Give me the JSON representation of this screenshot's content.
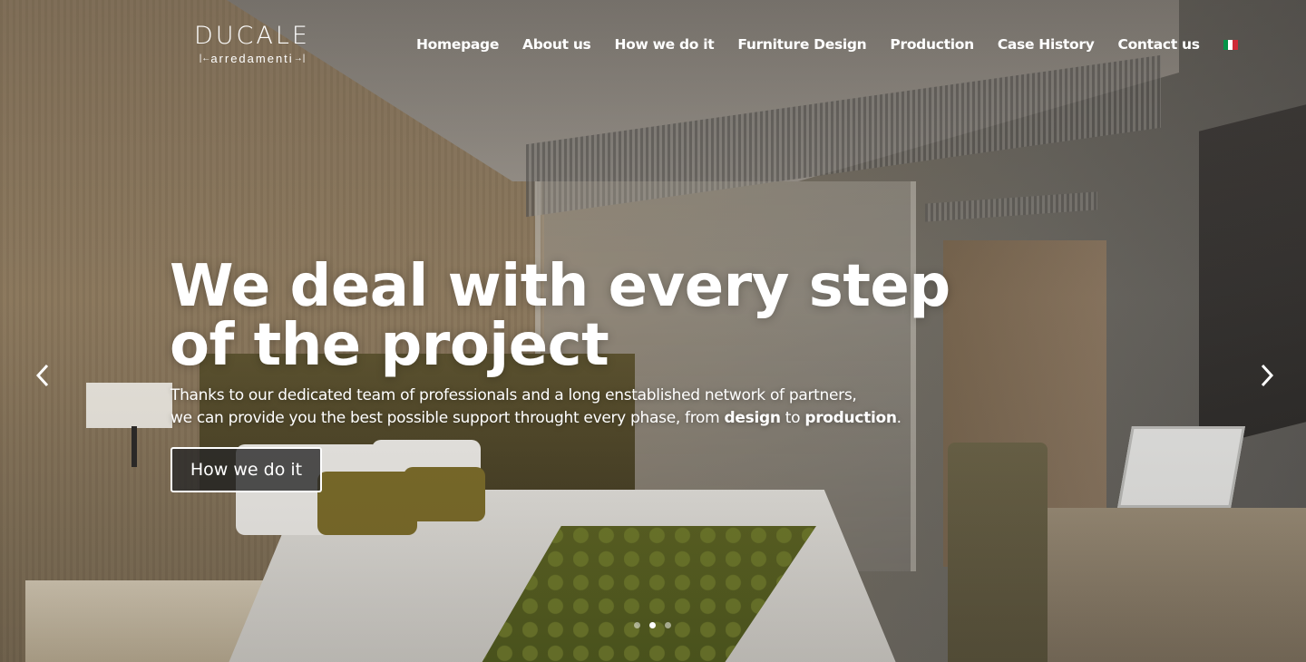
{
  "logo": {
    "name": "DUCALE",
    "tagline": "arredamenti"
  },
  "nav": {
    "items": [
      {
        "label": "Homepage"
      },
      {
        "label": "About us"
      },
      {
        "label": "How we do it"
      },
      {
        "label": "Furniture Design"
      },
      {
        "label": "Production"
      },
      {
        "label": "Case History"
      },
      {
        "label": "Contact us"
      }
    ],
    "language_icon": "italian-flag-icon",
    "flag_colors": [
      "#009246",
      "#ffffff",
      "#ce2b37"
    ]
  },
  "hero": {
    "headline_line1": "We deal with every step",
    "headline_line2": "of the project",
    "sub_line1": "Thanks to our dedicated team of professionals and a long enstablished network of partners,",
    "sub_line2_pre": "we can provide you the best possible support throught every phase, from ",
    "sub_bold1": "design",
    "sub_mid": " to ",
    "sub_bold2": "production",
    "sub_end": ".",
    "cta_label": "How we do it"
  },
  "slider": {
    "prev_icon": "chevron-left-icon",
    "next_icon": "chevron-right-icon",
    "slide_count": 3,
    "active_index": 1
  }
}
